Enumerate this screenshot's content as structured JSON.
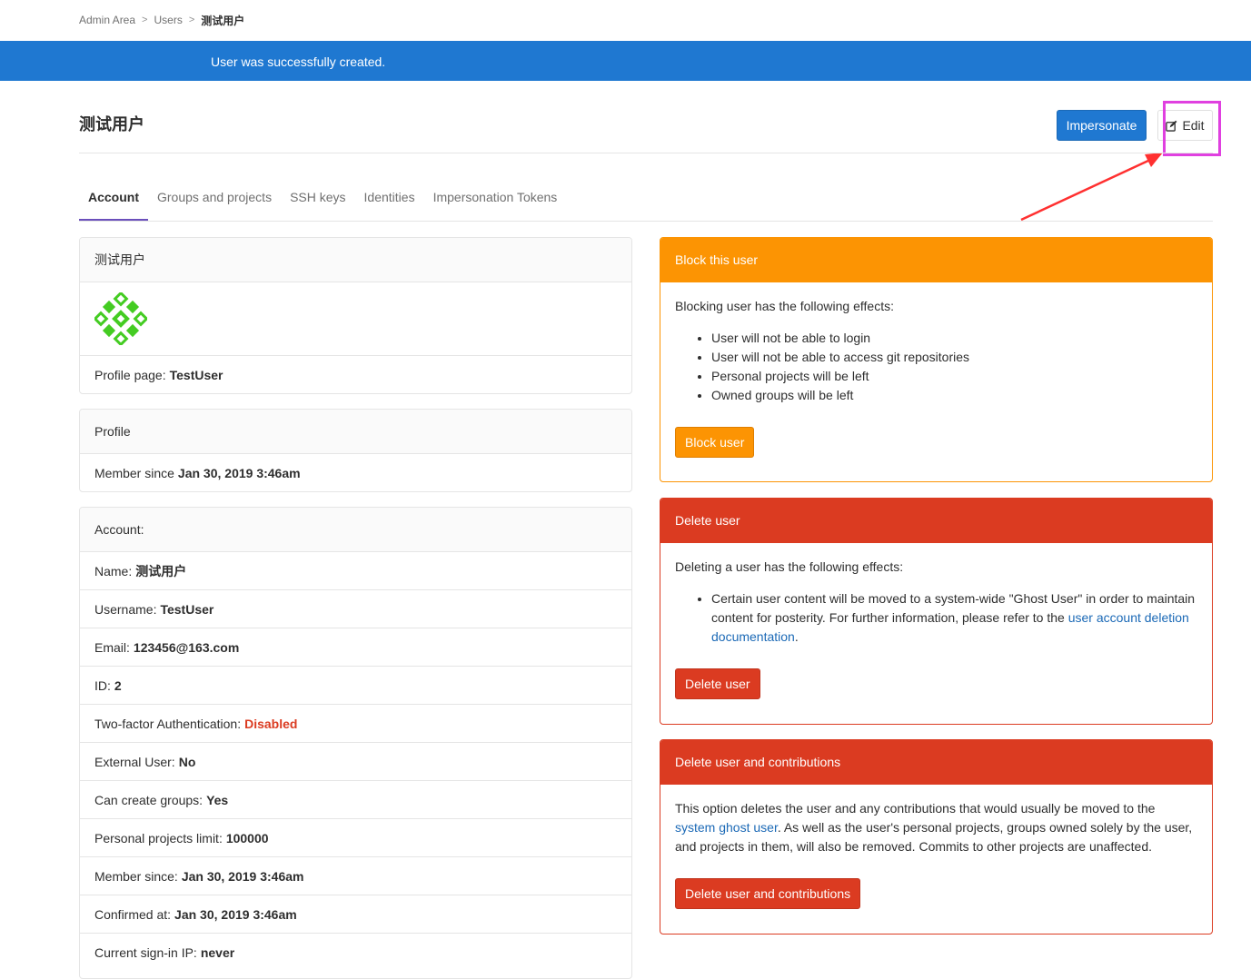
{
  "breadcrumb": {
    "items": [
      "Admin Area",
      "Users"
    ],
    "current": "测试用户"
  },
  "flash": {
    "message": "User was successfully created."
  },
  "header": {
    "title": "测试用户",
    "impersonate_label": "Impersonate",
    "edit_label": "Edit"
  },
  "tabs": [
    {
      "label": "Account",
      "active": true
    },
    {
      "label": "Groups and projects"
    },
    {
      "label": "SSH keys"
    },
    {
      "label": "Identities"
    },
    {
      "label": "Impersonation Tokens"
    }
  ],
  "user_card": {
    "title": "测试用户",
    "profile_page_label": "Profile page:",
    "profile_page_value": "TestUser"
  },
  "profile_card": {
    "title": "Profile",
    "member_since_label": "Member since",
    "member_since_value": "Jan 30, 2019 3:46am"
  },
  "account_card": {
    "title": "Account:",
    "rows": [
      {
        "label": "Name:",
        "value": "测试用户"
      },
      {
        "label": "Username:",
        "value": "TestUser"
      },
      {
        "label": "Email:",
        "value": "123456@163.com"
      },
      {
        "label": "ID:",
        "value": "2"
      },
      {
        "label": "Two-factor Authentication:",
        "value": "Disabled"
      },
      {
        "label": "External User:",
        "value": "No"
      },
      {
        "label": "Can create groups:",
        "value": "Yes"
      },
      {
        "label": "Personal projects limit:",
        "value": "100000"
      },
      {
        "label": "Member since:",
        "value": "Jan 30, 2019 3:46am"
      },
      {
        "label": "Confirmed at:",
        "value": "Jan 30, 2019 3:46am"
      },
      {
        "label": "Current sign-in IP:",
        "value": "never"
      }
    ]
  },
  "block_card": {
    "title": "Block this user",
    "intro": "Blocking user has the following effects:",
    "effects": [
      "User will not be able to login",
      "User will not be able to access git repositories",
      "Personal projects will be left",
      "Owned groups will be left"
    ],
    "button": "Block user"
  },
  "delete_card": {
    "title": "Delete user",
    "intro": "Deleting a user has the following effects:",
    "effect_text": "Certain user content will be moved to a system-wide \"Ghost User\" in order to maintain content for posterity. For further information, please refer to the",
    "effect_link": "user account deletion documentation",
    "button": "Delete user"
  },
  "delete_contrib_card": {
    "title": "Delete user and contributions",
    "text_before": "This option deletes the user and any contributions that would usually be moved to the",
    "link": "system ghost user",
    "text_after": ". As well as the user's personal projects, groups owned solely by the user, and projects in them, will also be removed. Commits to other projects are unaffected.",
    "button": "Delete user and contributions"
  },
  "colors": {
    "primary": "#1f78d1",
    "warning": "#fc9403",
    "danger": "#db3b21",
    "tab_active": "#6b4fbb",
    "annotation": "#e040e0",
    "arrow": "#ff3030",
    "avatar": "#44cc22"
  }
}
